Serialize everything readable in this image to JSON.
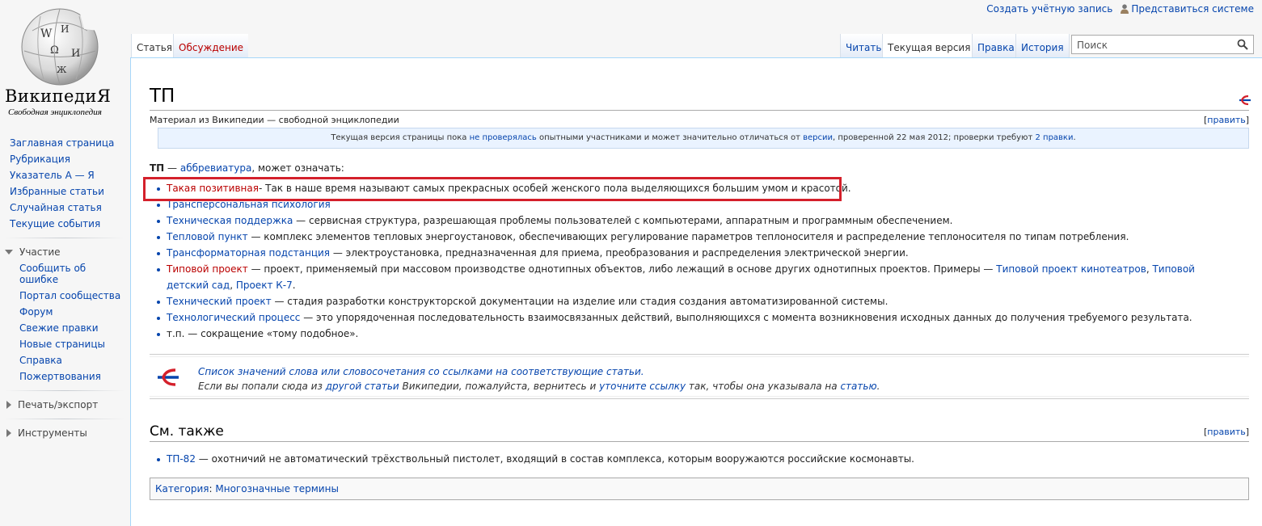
{
  "logo": {
    "title": "ВикипедиЯ",
    "tagline": "Свободная энциклопедия"
  },
  "personal": {
    "create_account": "Создать учётную запись",
    "login": "Представиться системе"
  },
  "sidebar": {
    "navigation": [
      "Заглавная страница",
      "Рубрикация",
      "Указатель А — Я",
      "Избранные статьи",
      "Случайная статья",
      "Текущие события"
    ],
    "participation": {
      "heading": "Участие",
      "items": [
        "Сообщить об ошибке",
        "Портал сообщества",
        "Форум",
        "Свежие правки",
        "Новые страницы",
        "Справка",
        "Пожертвования"
      ]
    },
    "print_export": "Печать/экспорт",
    "tools": "Инструменты"
  },
  "tabs": {
    "article": "Статья",
    "talk": "Обсуждение",
    "read": "Читать",
    "current_version": "Текущая версия",
    "edit": "Правка",
    "history": "История"
  },
  "search": {
    "placeholder": "Поиск",
    "value": ""
  },
  "page": {
    "title": "ТП",
    "site_sub": "Материал из Википедии — свободной энциклопедии",
    "edit_label": "править",
    "flagged": {
      "prefix": "Текущая версия страницы пока ",
      "link1": "не проверялась",
      "mid1": " опытными участниками и может значительно отличаться от ",
      "link2": "версии",
      "mid2": ", проверенной 22 мая 2012; проверки требуют ",
      "link3": "2 правки",
      "suffix": "."
    },
    "intro": {
      "bold": "ТП",
      "dash": " — ",
      "link": "аббревиатура",
      "rest": ", может означать:"
    },
    "meanings": [
      {
        "link": "Такая позитивная",
        "link_new": true,
        "text": "- Так в наше время называют самых прекрасных особей женского пола выделяющихся большим умом и красотой."
      },
      {
        "link": "Трансперсональная психология",
        "link_new": false,
        "text": ""
      },
      {
        "link": "Техническая поддержка",
        "link_new": false,
        "text": " — сервисная структура, разрешающая проблемы пользователей с компьютерами, аппаратным и программным обеспечением."
      },
      {
        "link": "Тепловой пункт",
        "link_new": false,
        "text": " — комплекс элементов тепловых энергоустановок, обеспечивающих регулирование параметров теплоносителя и распределение теплоносителя по типам потребления."
      },
      {
        "link": "Трансформаторная подстанция",
        "link_new": false,
        "text": " — электроустановка, предназначенная для приема, преобразования и распределения электрической энергии."
      },
      {
        "link": "Типовой проект",
        "link_new": true,
        "text": " — проект, применяемый при массовом производстве однотипных объектов, либо лежащий в основе других однотипных проектов. Примеры — ",
        "extra_links": [
          "Типовой проект кинотеатров",
          "Типовой детский сад",
          "Проект К-7"
        ],
        "extra_seps": [
          ", ",
          ", "
        ],
        "end": "."
      },
      {
        "link": "Технический проект",
        "link_new": false,
        "text": " — стадия разработки конструкторской документации на изделие или стадия создания автоматизированной системы."
      },
      {
        "link": "Технологический процесс",
        "link_new": false,
        "text": " — это упорядоченная последовательность взаимосвязанных действий, выполняющихся с момента возникновения исходных данных до получения требуемого результата."
      },
      {
        "link": "",
        "link_new": false,
        "text": "т.п. — сокращение «тому подобное»."
      }
    ],
    "disambig": {
      "line1": "Список значений слова или словосочетания со ссылками на соответствующие статьи.",
      "line2_a": "Если вы попали сюда из ",
      "line2_link1": "другой статьи",
      "line2_b": " Википедии, пожалуйста, вернитесь и ",
      "line2_link2": "уточните ссылку",
      "line2_c": " так, чтобы она указывала на ",
      "line2_link3": "статью",
      "line2_d": "."
    },
    "see_also": {
      "title": "См. также",
      "items": [
        {
          "link": "ТП-82",
          "text": " — охотничий не автоматический трёхствольный пистолет, входящий в состав комплекса, которым вооружаются российские космонавты."
        }
      ]
    },
    "categories": {
      "label": "Категория",
      "sep": ": ",
      "items": [
        "Многозначные термины"
      ]
    }
  },
  "colors": {
    "link": "#0645ad",
    "new_link": "#ba0000",
    "highlight": "#d4202b",
    "content_border": "#a7d7f9"
  }
}
